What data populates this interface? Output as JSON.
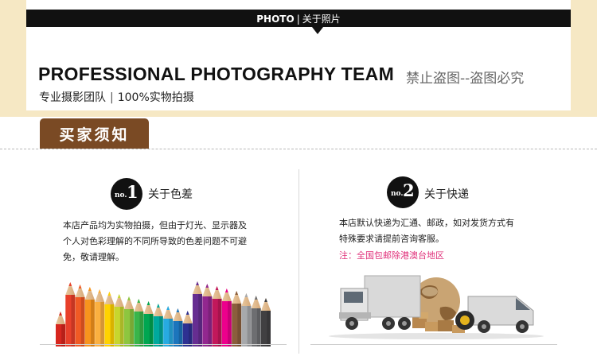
{
  "header": {
    "bar_en": "PHOTO",
    "bar_sep": "|",
    "bar_cn": "关于照片",
    "headline_en": "PROFESSIONAL PHOTOGRAPHY TEAM",
    "headline_cn": "禁止盗图--盗图必究",
    "sub_left": "专业摄影团队",
    "sub_sep": "|",
    "sub_right": "100%实物拍摄"
  },
  "section_tab": "买家须知",
  "left": {
    "badge_no": "no.",
    "badge_num": "1",
    "title": "关于色差",
    "lines": [
      "本店产品均为实物拍摄，但由于灯光、显示器及",
      "个人对色彩理解的不同所导致的色差问题不可避",
      "免，敬请理解。"
    ]
  },
  "right": {
    "badge_no": "no.",
    "badge_num": "2",
    "title": "关于快递",
    "lines": [
      "本店默认快递为汇通、邮政，如对发货方式有",
      "特殊要求请提前咨询客服。"
    ],
    "note": "注：全国包邮除港澳台地区"
  },
  "colors": {
    "tab_brown": "#7a4a24",
    "bar_black": "#111111",
    "note_pink": "#e0307a",
    "outer_cream": "#f6e8c4"
  },
  "images": {
    "left": "colored-pencils",
    "right": "delivery-trucks-globe-boxes"
  }
}
